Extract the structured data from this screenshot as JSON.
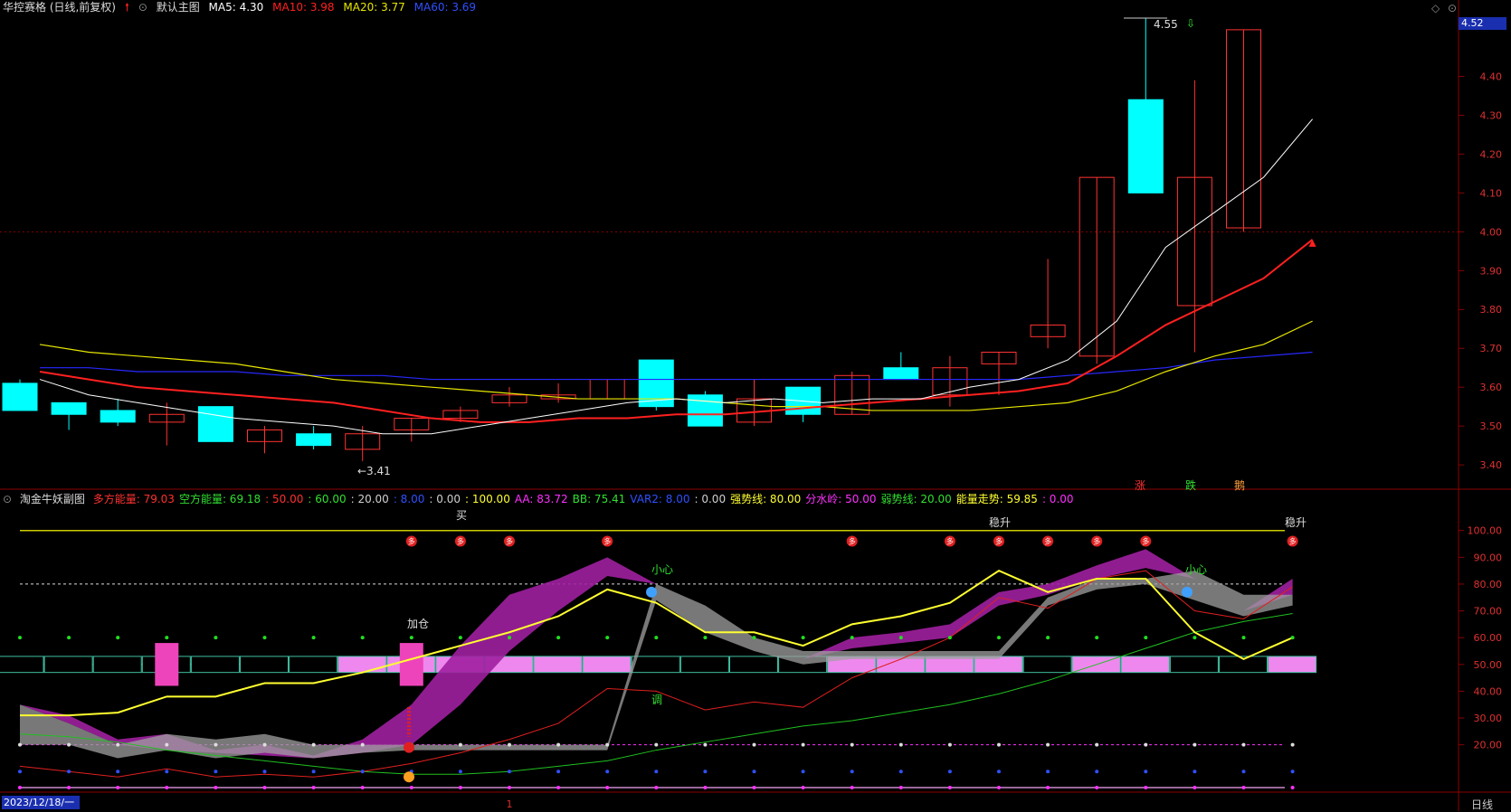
{
  "header": {
    "stock": "华控赛格 (日线,前复权)",
    "main_label": "默认主图",
    "ma5": "MA5: 4.30",
    "ma10": "MA10: 3.98",
    "ma20": "MA20: 3.77",
    "ma60": "MA60: 3.69"
  },
  "price_axis": [
    "4.40",
    "4.30",
    "4.20",
    "4.10",
    "4.00",
    "3.90",
    "3.80",
    "3.70",
    "3.60",
    "3.50",
    "3.40"
  ],
  "current_price": "4.52",
  "high_label": "4.55",
  "low_label": "←3.41",
  "signal_labels": [
    "涨",
    "跌",
    "鹅"
  ],
  "sub_header": {
    "name": "淘金牛妖副图",
    "items": [
      {
        "t": "多方能量: 79.03",
        "c": "#ff3030"
      },
      {
        "t": "空方能量: 69.18",
        "c": "#30e030"
      },
      {
        "t": ": 50.00",
        "c": "#ff3030"
      },
      {
        "t": ": 60.00",
        "c": "#30e030"
      },
      {
        "t": ": 20.00",
        "c": "#d0d0d0"
      },
      {
        "t": ": 8.00",
        "c": "#3050ff"
      },
      {
        "t": ": 0.00",
        "c": "#d0d0d0"
      },
      {
        "t": ": 100.00",
        "c": "#ffff30"
      },
      {
        "t": "AA: 83.72",
        "c": "#ff30ff"
      },
      {
        "t": "BB: 75.41",
        "c": "#30e030"
      },
      {
        "t": "VAR2: 8.00",
        "c": "#3050ff"
      },
      {
        "t": ": 0.00",
        "c": "#d0d0d0"
      },
      {
        "t": "强势线: 80.00",
        "c": "#ffff30"
      },
      {
        "t": "分水岭: 50.00",
        "c": "#ff30ff"
      },
      {
        "t": "弱势线: 20.00",
        "c": "#30e030"
      },
      {
        "t": "能量走势: 59.85",
        "c": "#ffff30"
      },
      {
        "t": ": 0.00",
        "c": "#ff30ff"
      }
    ]
  },
  "sub_axis": [
    "100.00",
    "90.00",
    "80.00",
    "70.00",
    "60.00",
    "50.00",
    "40.00",
    "30.00",
    "20.00"
  ],
  "sub_labels": {
    "buy": "买",
    "add": "加仓",
    "steady1": "稳升",
    "steady2": "稳升",
    "careful1": "小心",
    "careful2": "小心",
    "adjust": "调",
    "duo": "多"
  },
  "date": "2023/12/18/一",
  "period": "日线",
  "colors": {
    "up": "#ff3232",
    "down": "#00ffff",
    "ma5": "#ffffff",
    "ma10": "#ff2020",
    "ma20": "#e6e600",
    "ma60": "#2828ff"
  },
  "chart_data": {
    "type": "candlestick",
    "ylim": [
      3.37,
      4.55
    ],
    "candles": [
      {
        "o": 3.61,
        "c": 3.54,
        "h": 3.62,
        "l": 3.54
      },
      {
        "o": 3.56,
        "c": 3.53,
        "h": 3.56,
        "l": 3.49
      },
      {
        "o": 3.54,
        "c": 3.51,
        "h": 3.57,
        "l": 3.5
      },
      {
        "o": 3.51,
        "c": 3.53,
        "h": 3.56,
        "l": 3.45
      },
      {
        "o": 3.55,
        "c": 3.46,
        "h": 3.55,
        "l": 3.46
      },
      {
        "o": 3.46,
        "c": 3.49,
        "h": 3.5,
        "l": 3.43
      },
      {
        "o": 3.48,
        "c": 3.45,
        "h": 3.5,
        "l": 3.44
      },
      {
        "o": 3.44,
        "c": 3.48,
        "h": 3.5,
        "l": 3.41
      },
      {
        "o": 3.49,
        "c": 3.52,
        "h": 3.52,
        "l": 3.46
      },
      {
        "o": 3.52,
        "c": 3.54,
        "h": 3.55,
        "l": 3.51
      },
      {
        "o": 3.56,
        "c": 3.58,
        "h": 3.6,
        "l": 3.55
      },
      {
        "o": 3.57,
        "c": 3.58,
        "h": 3.61,
        "l": 3.56
      },
      {
        "o": 3.57,
        "c": 3.62,
        "h": 3.62,
        "l": 3.57
      },
      {
        "o": 3.67,
        "c": 3.55,
        "h": 3.67,
        "l": 3.54
      },
      {
        "o": 3.58,
        "c": 3.5,
        "h": 3.59,
        "l": 3.5
      },
      {
        "o": 3.51,
        "c": 3.57,
        "h": 3.62,
        "l": 3.5
      },
      {
        "o": 3.6,
        "c": 3.53,
        "h": 3.6,
        "l": 3.51
      },
      {
        "o": 3.53,
        "c": 3.63,
        "h": 3.64,
        "l": 3.53
      },
      {
        "o": 3.65,
        "c": 3.62,
        "h": 3.69,
        "l": 3.62
      },
      {
        "o": 3.58,
        "c": 3.65,
        "h": 3.68,
        "l": 3.55
      },
      {
        "o": 3.66,
        "c": 3.69,
        "h": 3.69,
        "l": 3.58
      },
      {
        "o": 3.73,
        "c": 3.76,
        "h": 3.93,
        "l": 3.7
      },
      {
        "o": 3.68,
        "c": 4.14,
        "h": 4.14,
        "l": 3.66
      },
      {
        "o": 4.34,
        "c": 4.1,
        "h": 4.55,
        "l": 4.1
      },
      {
        "o": 3.81,
        "c": 4.14,
        "h": 4.39,
        "l": 3.69
      },
      {
        "o": 4.01,
        "c": 4.52,
        "h": 4.52,
        "l": 4.0
      }
    ],
    "ma5": [
      3.62,
      3.58,
      3.56,
      3.54,
      3.52,
      3.51,
      3.5,
      3.48,
      3.48,
      3.5,
      3.52,
      3.54,
      3.56,
      3.57,
      3.56,
      3.57,
      3.56,
      3.57,
      3.57,
      3.6,
      3.62,
      3.67,
      3.77,
      3.96,
      4.05,
      4.14,
      4.29
    ],
    "ma10": [
      3.64,
      3.62,
      3.6,
      3.59,
      3.58,
      3.57,
      3.56,
      3.54,
      3.52,
      3.51,
      3.51,
      3.52,
      3.52,
      3.53,
      3.53,
      3.54,
      3.55,
      3.56,
      3.57,
      3.58,
      3.59,
      3.61,
      3.68,
      3.76,
      3.82,
      3.88,
      3.98
    ],
    "ma20": [
      3.71,
      3.69,
      3.68,
      3.67,
      3.66,
      3.64,
      3.62,
      3.61,
      3.6,
      3.59,
      3.58,
      3.57,
      3.57,
      3.57,
      3.56,
      3.55,
      3.55,
      3.54,
      3.54,
      3.54,
      3.55,
      3.56,
      3.59,
      3.64,
      3.68,
      3.71,
      3.77
    ],
    "ma60": [
      3.65,
      3.65,
      3.64,
      3.64,
      3.64,
      3.63,
      3.63,
      3.63,
      3.62,
      3.62,
      3.62,
      3.62,
      3.62,
      3.62,
      3.62,
      3.62,
      3.62,
      3.62,
      3.62,
      3.62,
      3.62,
      3.63,
      3.64,
      3.65,
      3.67,
      3.68,
      3.69
    ],
    "sub_yellow": [
      31,
      31,
      32,
      38,
      38,
      43,
      43,
      47,
      52,
      57,
      62,
      68,
      78,
      73,
      62,
      62,
      57,
      65,
      68,
      73,
      85,
      77,
      82,
      82,
      62,
      52,
      60
    ],
    "sub_red": [
      12,
      10,
      8,
      11,
      8,
      9,
      8,
      10,
      13,
      17,
      22,
      28,
      41,
      40,
      33,
      36,
      34,
      45,
      52,
      60,
      75,
      71,
      82,
      85,
      70,
      67,
      79
    ],
    "sub_green": [
      24,
      23,
      21,
      18,
      16,
      14,
      12,
      10,
      9,
      9,
      10,
      12,
      14,
      18,
      21,
      24,
      27,
      29,
      32,
      35,
      39,
      44,
      50,
      56,
      62,
      66,
      69
    ],
    "sub_pink_blocks": [
      0,
      0,
      0,
      1,
      0,
      0,
      0,
      1,
      0,
      0,
      0,
      0,
      0,
      0,
      0,
      0,
      0,
      0,
      0,
      0,
      0,
      0,
      0,
      0,
      0,
      0,
      0
    ]
  }
}
